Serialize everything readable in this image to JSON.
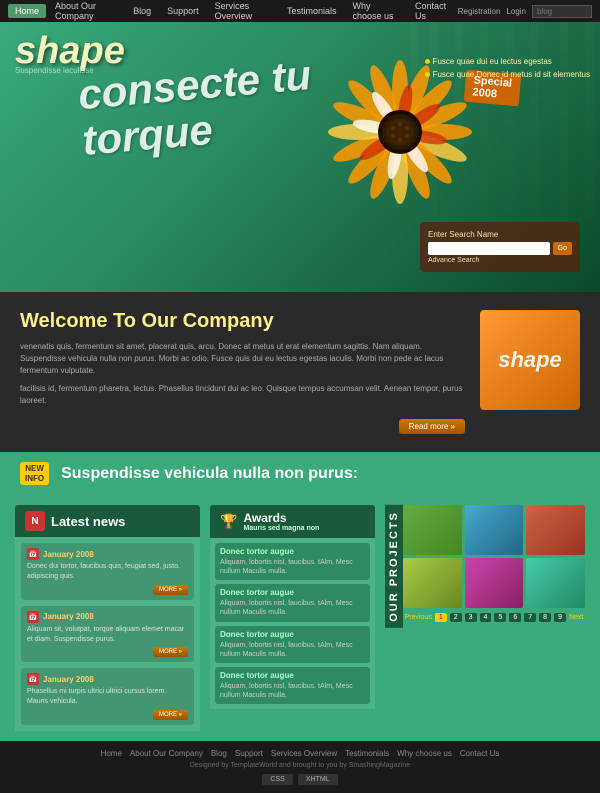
{
  "nav": {
    "items": [
      {
        "label": "Home",
        "active": true
      },
      {
        "label": "About Our Company"
      },
      {
        "label": "Blog"
      },
      {
        "label": "Support"
      },
      {
        "label": "Services Overview"
      },
      {
        "label": "Testimonials"
      },
      {
        "label": "Why choose us"
      },
      {
        "label": "Contact Us"
      }
    ],
    "right": {
      "login": "Login",
      "register": "Registration",
      "search_placeholder": "blog"
    }
  },
  "hero": {
    "logo": "shape",
    "logo_sub": "Suspendisse iaculisse",
    "tagline_line1": "consecte tu",
    "tagline_line2": "torque",
    "special": "Special",
    "year": "2008",
    "bullets": [
      "Fusce quae dui eu lectus egestas",
      "Fusce quae Donec id metus id sit elementus"
    ],
    "search": {
      "label": "Enter Search Name",
      "advance": "Advance Search",
      "go": "Go"
    }
  },
  "welcome": {
    "title": "Welcome To Our Company",
    "body1": "venenatis quis, fermentum sit amet, placerat quis, arcu. Donec at metus ut erat elementum sagittis. Nam aliquam. Suspendisse vehicula nulla non purus. Morbi ac odio. Fusce quis dui eu lectus egestas iaculis. Morbi non pede ac lacus fermentum vulputate.",
    "body2": "facilisis id, fermentum pharetra, lectus. Phasellus tincidunt dui ac leo. Quisque tempus accumsan velit. Aenean tempor, purus laoreet.",
    "read_more": "Read more »"
  },
  "highlight": {
    "badge_line1": "NEW",
    "badge_line2": "INFO",
    "text": "Suspendisse vehicula nulla non purus:"
  },
  "latest_news": {
    "title": "Latest news",
    "items": [
      {
        "date": "January 2008",
        "excerpt": "Donec dui tortor, faucibus quis, feugiat sed, justo. adipiscing quis.",
        "more": "MORE »"
      },
      {
        "date": "January 2008",
        "excerpt": "Aliquam sit, volutpat, torque aliquam elemet macar et diam. Suspendisse purus.",
        "more": "MORE »"
      },
      {
        "date": "January 2008",
        "excerpt": "Phasellus mi turpis ultrici ultrici cursus lorem. Mauris vehicula.",
        "more": "MORE »"
      }
    ]
  },
  "awards": {
    "title": "Awards",
    "subtitle": "Mauris sed magna non",
    "items": [
      {
        "title": "Donec tortor augue",
        "desc": "Aliquam, lobortis nisl, faucibus. tAlm, Mesc nullum Maculis mulla."
      },
      {
        "title": "Donec tortor augue",
        "desc": "Aliquam, lobortis nisl, faucibus. tAlm, Mesc nullum Maculis mulla."
      },
      {
        "title": "Donec tortor augue",
        "desc": "Aliquam, lobortis nisl, faucibus. tAlm, Mesc nullum Maculis mulla."
      },
      {
        "title": "Donec tortor augue",
        "desc": "Aliquam, lobortis nisl, faucibus. tAlm, Mesc nullum Maculis mulla."
      }
    ]
  },
  "projects": {
    "label": "OUR PROJECTS",
    "prev": "Previous",
    "next": "Next",
    "pages": [
      "1",
      "2",
      "3",
      "4",
      "5",
      "6",
      "7",
      "8",
      "9"
    ]
  },
  "footer": {
    "links": [
      "Home",
      "About Our Company",
      "Blog",
      "Support",
      "Services Overview",
      "Testimonials",
      "Why choose us",
      "Contact Us"
    ],
    "credit": "Designed by TemplateWorld and brought to you by SmashingMagazine",
    "buttons": [
      "CSS",
      "XHTML"
    ]
  }
}
